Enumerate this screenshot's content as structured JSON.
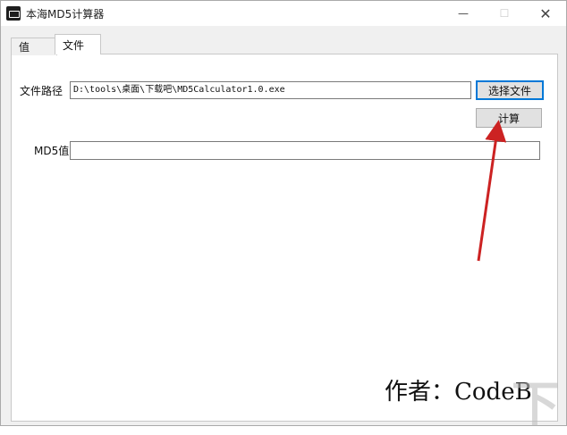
{
  "window": {
    "title": "本海MD5计算器",
    "min_glyph": "—",
    "max_glyph": "☐",
    "close_glyph": "✕"
  },
  "tabs": [
    {
      "label": "值"
    },
    {
      "label": "文件"
    }
  ],
  "file": {
    "path_label": "文件路径",
    "path_value": "D:\\tools\\桌面\\下载吧\\MD5Calculator1.0.exe",
    "choose_button": "选择文件",
    "calc_button": "计算",
    "md5_label": "MD5值",
    "md5_value": ""
  },
  "author_text": "作者：CodeB",
  "watermark_text": "下",
  "colors": {
    "accent": "#0078d7",
    "arrow": "#cc2222"
  }
}
